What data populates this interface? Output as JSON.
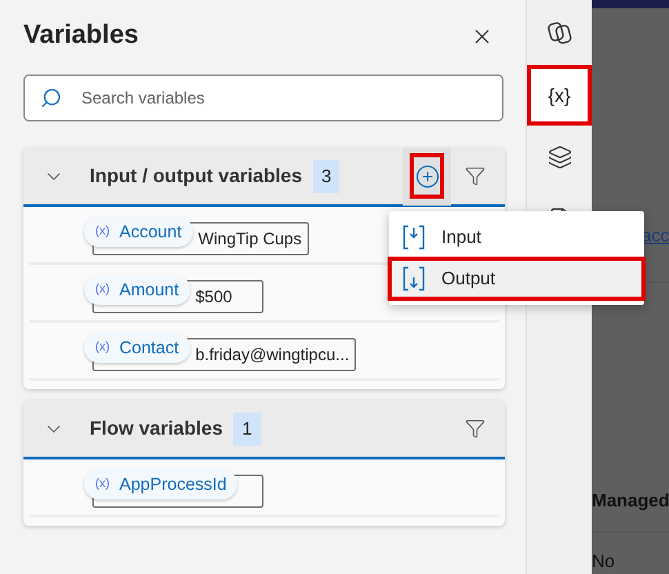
{
  "panel": {
    "title": "Variables",
    "search": {
      "placeholder": "Search variables"
    }
  },
  "sections": [
    {
      "title": "Input / output variables",
      "count": "3",
      "expanded": true,
      "add_button": {
        "highlighted": true
      },
      "variables": [
        {
          "badge": "(x)",
          "name": "Account",
          "value": "WingTip Cups"
        },
        {
          "badge": "(x)",
          "name": "Amount",
          "value": "$500"
        },
        {
          "badge": "(x)",
          "name": "Contact",
          "value": "b.friday@wingtipcu..."
        }
      ]
    },
    {
      "title": "Flow variables",
      "count": "1",
      "expanded": true,
      "variables": [
        {
          "badge": "(x)",
          "name": "AppProcessId"
        }
      ]
    }
  ],
  "add_menu": {
    "items": [
      {
        "kind": "input",
        "label": "Input",
        "highlighted": false
      },
      {
        "kind": "output",
        "label": "Output",
        "highlighted": true
      }
    ]
  },
  "rail": {
    "items": [
      {
        "kind": "copilot",
        "selected": false,
        "highlighted": false
      },
      {
        "kind": "variables",
        "label": "{x}",
        "selected": true,
        "highlighted": true
      },
      {
        "kind": "layers",
        "selected": false,
        "highlighted": false
      },
      {
        "kind": "document",
        "selected": false,
        "highlighted": false
      }
    ]
  },
  "background": {
    "link": "acc",
    "column_header": "Managed",
    "cell": "No"
  }
}
